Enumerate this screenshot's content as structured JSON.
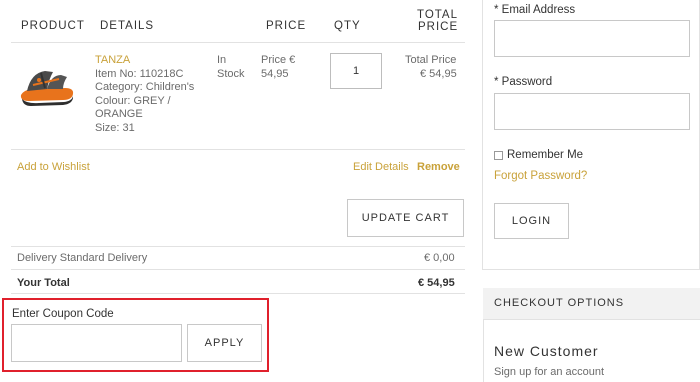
{
  "cart": {
    "headers": {
      "product": "PRODUCT",
      "details": "DETAILS",
      "price": "PRICE",
      "qty": "QTY",
      "total_line1": "TOTAL",
      "total_line2": "PRICE"
    },
    "item": {
      "name": "TANZA",
      "item_no": "Item No: 110218C",
      "category_line1": "Category: Children's",
      "colour_line1": "Colour: GREY /",
      "colour_line2": "ORANGE",
      "size": "Size: 31",
      "stock_line1": "In",
      "stock_line2": "Stock",
      "price_line1": "Price €",
      "price_line2": "54,95",
      "quantity": "1",
      "total_line1": "Total Price",
      "total_line2": "€ 54,95",
      "image_icon": "sandal-product-image"
    },
    "actions": {
      "wishlist": "Add to Wishlist",
      "edit": "Edit Details",
      "remove": "Remove",
      "update": "UPDATE CART"
    },
    "summary": {
      "delivery_label": "Delivery Standard Delivery",
      "delivery_value": "€ 0,00",
      "total_label": "Your Total",
      "total_value": "€ 54,95"
    },
    "coupon": {
      "label": "Enter Coupon Code",
      "value": "",
      "apply": "APPLY"
    }
  },
  "login": {
    "email_label": "* Email Address",
    "email_value": "",
    "password_label": "* Password",
    "password_value": "",
    "remember": "Remember Me",
    "forgot": "Forgot Password?",
    "login_button": "LOGIN"
  },
  "checkout": {
    "heading": "CHECKOUT OPTIONS",
    "new_customer": "New Customer",
    "signup": "Sign up for an account"
  },
  "colors": {
    "accent_gold": "#c9a23a",
    "highlight_red": "#e0202c",
    "sandal_grey": "#4a4a4a",
    "sandal_orange": "#e8731c"
  }
}
